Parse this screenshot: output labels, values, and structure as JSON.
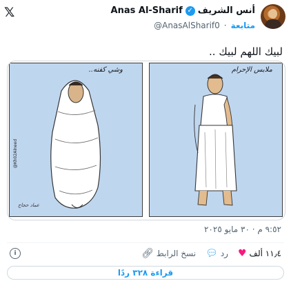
{
  "header": {
    "display_name_ar": "أنس الشريف",
    "display_name_en": "Anas Al-Sharif",
    "handle": "@AnasAlSharif0",
    "follow_label": "متابعة",
    "logo": "x-logo-icon"
  },
  "tweet": {
    "text": "لبيك اللهم لبيك .."
  },
  "media": {
    "left_caption": "وشي كفنه..",
    "right_caption": "ملابس الإحرام",
    "side_credit": "@Kh02Alneed",
    "signature": "عماد حجاج"
  },
  "meta": {
    "timestamp": "٩:٥٢ م · ٣٠ مايو ٢٠٢٥"
  },
  "actions": {
    "likes": "١١٫٤ ألف",
    "reply_label": "رد",
    "copy_link_label": "نسخ الرابط"
  },
  "footer": {
    "read_replies_label": "قراءة ٣٢٨ ردًا"
  },
  "colors": {
    "accent": "#1d9bf0",
    "like": "#f91880",
    "panel_bg": "#bfd6ef"
  }
}
